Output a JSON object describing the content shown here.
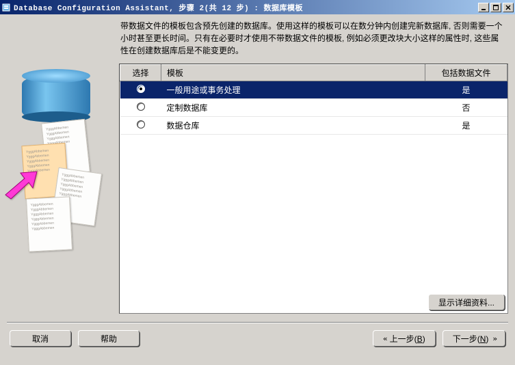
{
  "window": {
    "title": "Database Configuration Assistant, 步骤 2(共 12 步) : 数据库模板"
  },
  "description": "带数据文件的模板包含预先创建的数据库。使用这样的模板可以在数分钟内创建完新数据库, 否则需要一个小时甚至更长时间。只有在必要时才使用不带数据文件的模板, 例如必须更改块大小这样的属性时, 这些属性在创建数据库后是不能变更的。",
  "table": {
    "headers": {
      "select": "选择",
      "template": "模板",
      "include": "包括数据文件"
    },
    "rows": [
      {
        "template": "一般用途或事务处理",
        "include": "是",
        "selected": true
      },
      {
        "template": "定制数据库",
        "include": "否",
        "selected": false
      },
      {
        "template": "数据仓库",
        "include": "是",
        "selected": false
      }
    ]
  },
  "buttons": {
    "detail": "显示详细资料...",
    "cancel": "取消",
    "help": "帮助",
    "back": "上一步",
    "back_key": "B",
    "next": "下一步",
    "next_key": "N"
  }
}
